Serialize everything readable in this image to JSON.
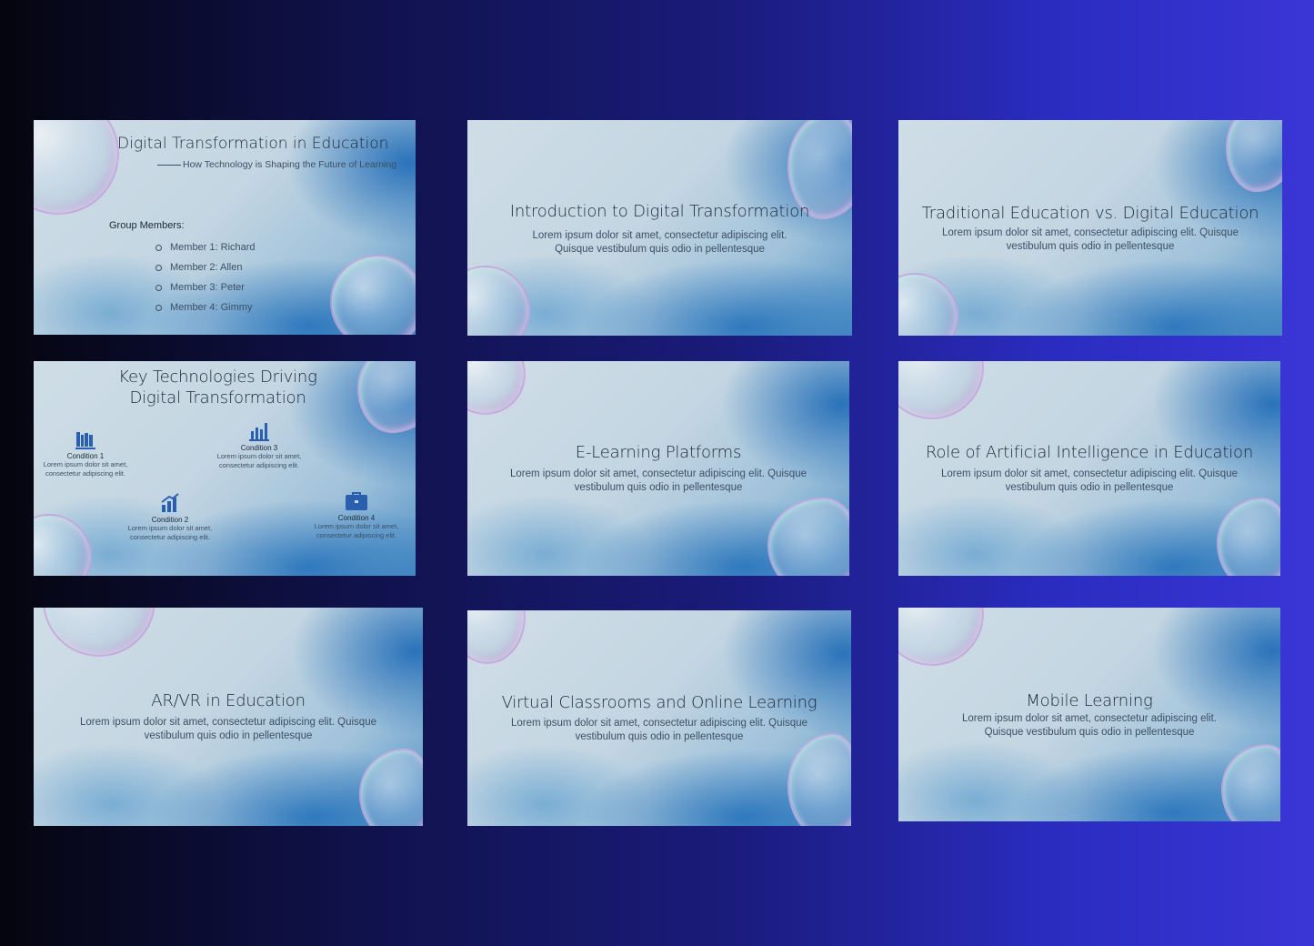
{
  "slides": [
    {
      "title": "Digital Transformation in Education",
      "subtitle": "How Technology is Shaping the Future of Learning",
      "group_label": "Group Members:",
      "members": [
        "Member 1: Richard",
        "Member 2: Allen",
        "Member 3: Peter",
        "Member 4: Gimmy"
      ]
    },
    {
      "title": "Introduction to Digital Transformation",
      "body": "Lorem ipsum dolor sit amet, consectetur adipiscing elit. Quisque vestibulum quis odio in pellentesque"
    },
    {
      "title": "Traditional Education vs. Digital Education",
      "body": "Lorem ipsum dolor sit amet, consectetur adipiscing elit. Quisque vestibulum quis odio in pellentesque"
    },
    {
      "title": "Key Technologies Driving Digital Transformation",
      "conditions": [
        {
          "label": "Condition 1",
          "text": "Lorem ipsum dolor sit amet, consectetur adipiscing elit.",
          "icon": "books-icon"
        },
        {
          "label": "Condition 2",
          "text": "Lorem ipsum dolor sit amet, consectetur adipiscing elit.",
          "icon": "growth-chart-icon"
        },
        {
          "label": "Condition 3",
          "text": "Lorem ipsum dolor sit amet, consectetur adipiscing elit.",
          "icon": "bar-chart-icon"
        },
        {
          "label": "Condition 4",
          "text": "Lorem ipsum dolor sit amet, consectetur adipiscing elit.",
          "icon": "briefcase-icon"
        }
      ]
    },
    {
      "title": "E-Learning Platforms",
      "body": "Lorem ipsum dolor sit amet, consectetur adipiscing elit. Quisque vestibulum quis odio in pellentesque"
    },
    {
      "title": "Role of Artificial Intelligence in Education",
      "body": "Lorem ipsum dolor sit amet, consectetur adipiscing elit. Quisque vestibulum quis odio in pellentesque"
    },
    {
      "title": "AR/VR in Education",
      "body": "Lorem ipsum dolor sit amet, consectetur adipiscing elit. Quisque vestibulum quis odio in pellentesque"
    },
    {
      "title": "Virtual Classrooms and Online Learning",
      "body": "Lorem ipsum dolor sit amet, consectetur adipiscing elit. Quisque vestibulum quis odio in pellentesque"
    },
    {
      "title": "Mobile Learning",
      "body": "Lorem ipsum dolor sit amet, consectetur adipiscing elit. Quisque vestibulum quis odio in pellentesque"
    }
  ],
  "colors": {
    "background_start": "#05050f",
    "background_end": "#3a36d6",
    "icon_blue": "#2a5fb0",
    "title_text": "#1d2836"
  }
}
